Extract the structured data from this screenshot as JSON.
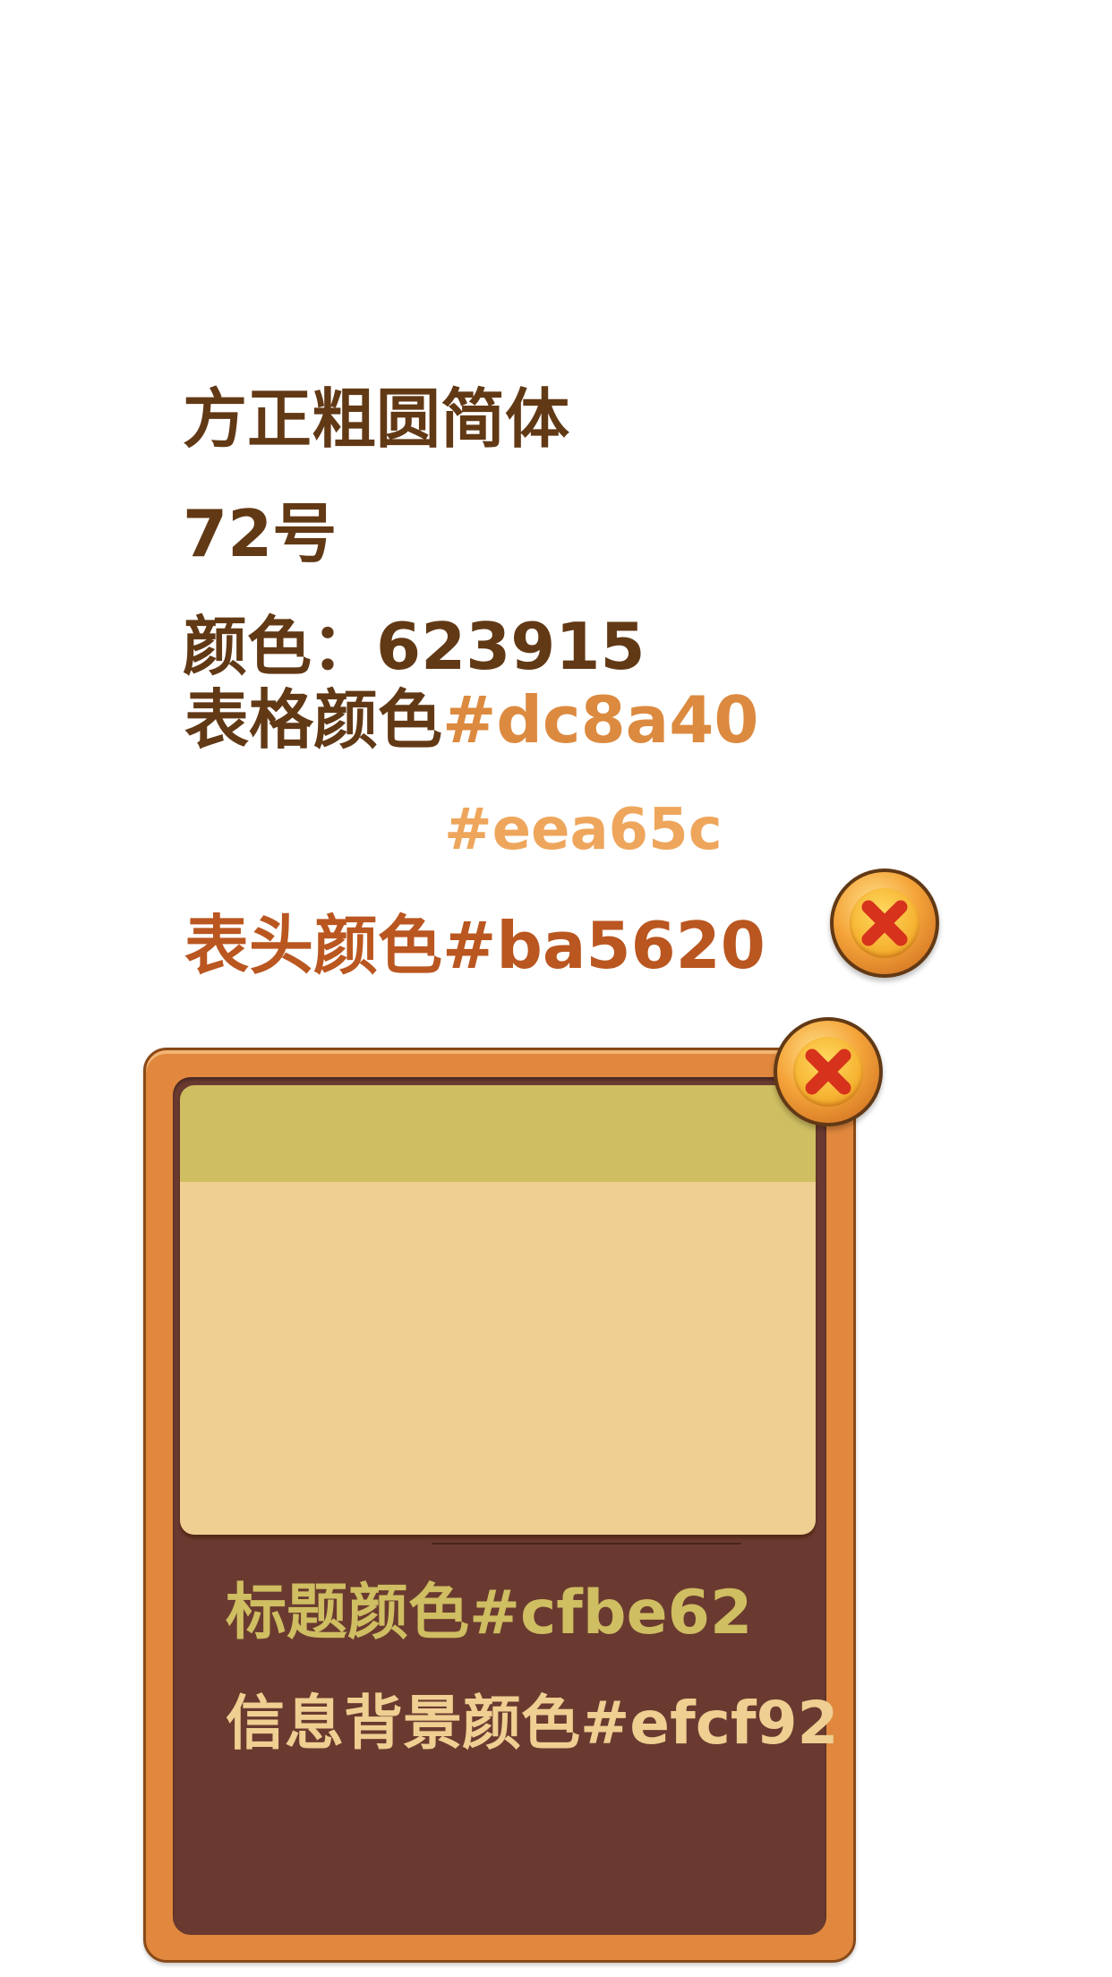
{
  "spec": {
    "font_name": "方正粗圆简体",
    "font_size": "72号",
    "text_color": "颜色：623915",
    "table_color_label": "表格颜色",
    "table_color_1": "#dc8a40",
    "table_color_2": "#eea65c",
    "header_color_label": "表头颜色",
    "header_color": "#ba5620"
  },
  "panel": {
    "title_color_text": "标题颜色#cfbe62",
    "info_bg_text": "信息背景颜色#efcf92"
  },
  "colors": {
    "text": "#623915",
    "table_1": "#dc8a40",
    "table_2": "#eea65c",
    "header": "#ba5620",
    "title": "#cfbe62",
    "info_bg": "#efcf92",
    "panel_dark": "#6a3a30"
  },
  "icons": {
    "close": "close-x-icon"
  }
}
